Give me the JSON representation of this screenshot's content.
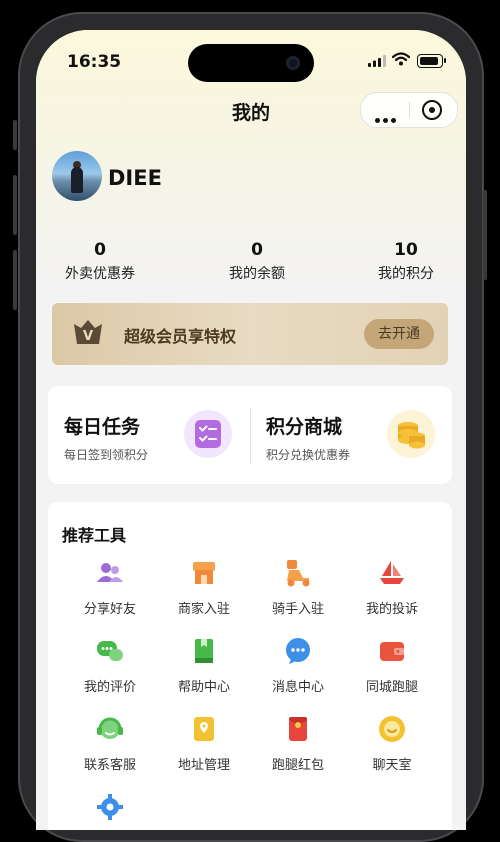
{
  "status": {
    "time": "16:35"
  },
  "nav": {
    "title": "我的"
  },
  "user": {
    "name": "DIEE"
  },
  "stats": [
    {
      "value": "0",
      "label": "外卖优惠券"
    },
    {
      "value": "0",
      "label": "我的余额"
    },
    {
      "value": "10",
      "label": "我的积分"
    }
  ],
  "vip": {
    "badge": "V",
    "text": "超级会员享特权",
    "button": "去开通"
  },
  "tasks": [
    {
      "title": "每日任务",
      "subtitle": "每日签到领积分",
      "icon": "checklist-icon"
    },
    {
      "title": "积分商城",
      "subtitle": "积分兑换优惠券",
      "icon": "coins-icon"
    }
  ],
  "tools": {
    "title": "推荐工具",
    "items": [
      {
        "label": "分享好友",
        "icon": "share-friends-icon",
        "color": "#9b6bd6"
      },
      {
        "label": "商家入驻",
        "icon": "shop-icon",
        "color": "#f08a3a"
      },
      {
        "label": "骑手入驻",
        "icon": "scooter-icon",
        "color": "#f08a3a"
      },
      {
        "label": "我的投诉",
        "icon": "complaint-boat-icon",
        "color": "#e8453c"
      },
      {
        "label": "我的评价",
        "icon": "comment-icon",
        "color": "#47b84a"
      },
      {
        "label": "帮助中心",
        "icon": "help-book-icon",
        "color": "#47b84a"
      },
      {
        "label": "消息中心",
        "icon": "message-icon",
        "color": "#3d8fe8"
      },
      {
        "label": "同城跑腿",
        "icon": "wallet-icon",
        "color": "#e8543c"
      },
      {
        "label": "联系客服",
        "icon": "customer-service-icon",
        "color": "#47b84a"
      },
      {
        "label": "地址管理",
        "icon": "address-icon",
        "color": "#f2c230"
      },
      {
        "label": "跑腿红包",
        "icon": "red-packet-icon",
        "color": "#e8453c"
      },
      {
        "label": "聊天室",
        "icon": "chatroom-icon",
        "color": "#f2c230"
      }
    ]
  }
}
